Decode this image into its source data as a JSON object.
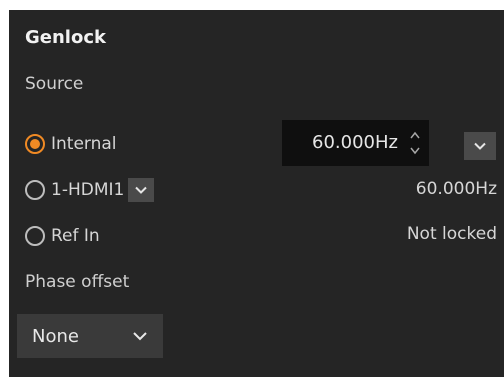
{
  "panel": {
    "title": "Genlock",
    "source_label": "Source",
    "phase_offset_label": "Phase offset"
  },
  "options": {
    "internal": {
      "label": "Internal",
      "selected": true
    },
    "hdmi": {
      "label": "1-HDMI1",
      "selected": false
    },
    "ref_in": {
      "label": "Ref In",
      "selected": false
    }
  },
  "internal_freq": {
    "value": "60.000Hz"
  },
  "hdmi_status": "60.000Hz",
  "ref_in_status": "Not locked",
  "phase_offset": {
    "value": "None"
  },
  "colors": {
    "panel_bg": "#252525",
    "accent": "#f08a24",
    "input_bg": "#0f0f0f",
    "button_bg": "#4a4a4a"
  },
  "icons": {
    "spinner": "up-down-arrows-icon",
    "dropdown": "chevron-down-icon"
  }
}
